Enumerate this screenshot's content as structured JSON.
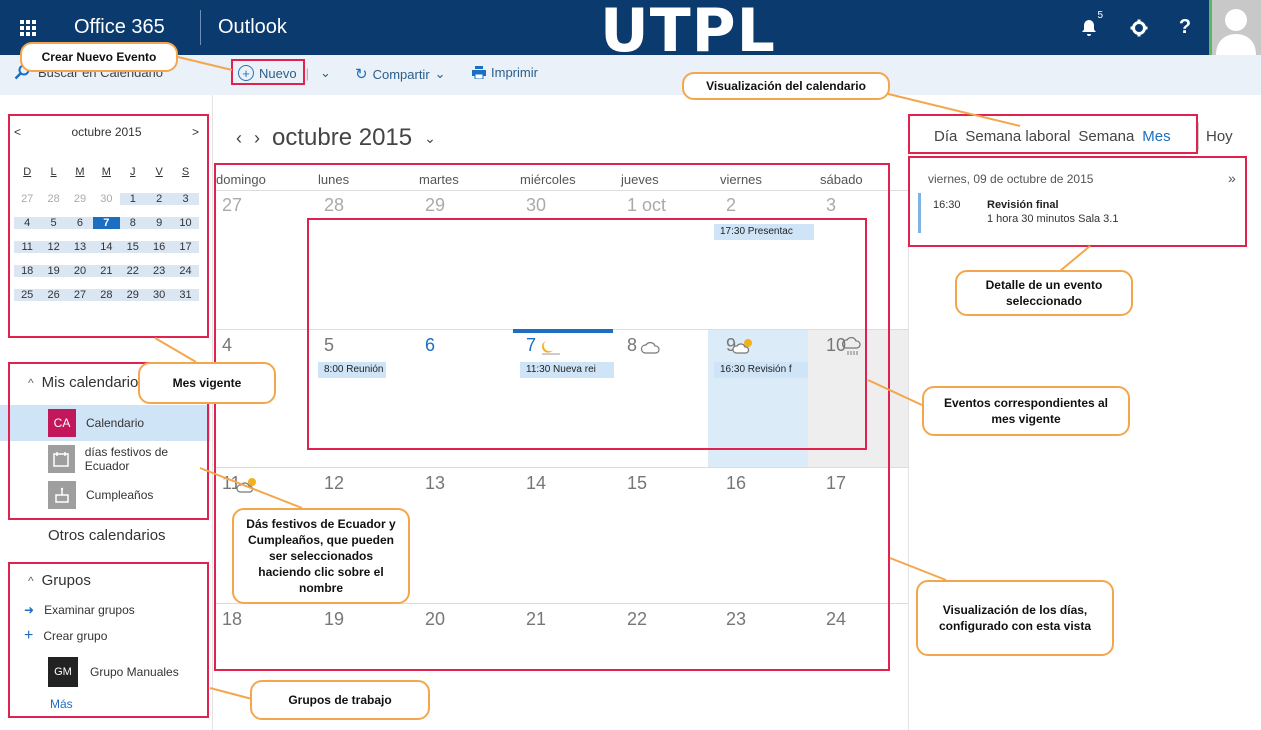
{
  "topbar": {
    "product": "Office 365",
    "app": "Outlook",
    "brand": "UTPL",
    "bell_count": "5",
    "icons": [
      "waffle-icon",
      "bell-icon",
      "gear-icon",
      "help-icon",
      "avatar-icon"
    ],
    "help_label": "?"
  },
  "commands": {
    "search_placeholder": "Buscar en Calendario",
    "new_label": "Nuevo",
    "share_label": "Compartir",
    "print_label": "Imprimir"
  },
  "mini_calendar": {
    "title": "octubre 2015",
    "dow": [
      "D",
      "L",
      "M",
      "M",
      "J",
      "V",
      "S"
    ],
    "weeks": [
      [
        "27",
        "28",
        "29",
        "30",
        "1",
        "2",
        "3"
      ],
      [
        "4",
        "5",
        "6",
        "7",
        "8",
        "9",
        "10"
      ],
      [
        "11",
        "12",
        "13",
        "14",
        "15",
        "16",
        "17"
      ],
      [
        "18",
        "19",
        "20",
        "21",
        "22",
        "23",
        "24"
      ],
      [
        "25",
        "26",
        "27",
        "28",
        "29",
        "30",
        "31"
      ]
    ]
  },
  "my_calendars": {
    "header": "Mis calendarios",
    "items": [
      {
        "badge": "CA",
        "label": "Calendario",
        "color": "#c2185b"
      },
      {
        "badge": "",
        "label": "días festivos de Ecuador",
        "color": "#9e9e9e"
      },
      {
        "badge": "",
        "label": "Cumpleaños",
        "color": "#9e9e9e"
      }
    ],
    "other": "Otros calendarios"
  },
  "groups": {
    "header": "Grupos",
    "browse": "Examinar grupos",
    "create": "Crear grupo",
    "group_badge": "GM",
    "group_name": "Grupo Manuales",
    "more": "Más"
  },
  "main": {
    "month_title": "octubre 2015",
    "columns": [
      "domingo",
      "lunes",
      "martes",
      "miércoles",
      "jueves",
      "viernes",
      "sábado"
    ],
    "weeks": [
      [
        "27",
        "28",
        "29",
        "30",
        "1 oct",
        "2",
        "3"
      ],
      [
        "4",
        "5",
        "6",
        "7",
        "8",
        "9",
        "10"
      ],
      [
        "11",
        "12",
        "13",
        "14",
        "15",
        "16",
        "17"
      ],
      [
        "18",
        "19",
        "20",
        "21",
        "22",
        "23",
        "24"
      ]
    ],
    "events": [
      {
        "label": "17:30 Presentac"
      },
      {
        "label": "8:00 Reunión"
      },
      {
        "label": "11:30 Nueva rei"
      },
      {
        "label": "16:30 Revisión f"
      }
    ]
  },
  "views": {
    "items": [
      "Día",
      "Semana laboral",
      "Semana",
      "Mes"
    ],
    "active": "Mes",
    "today": "Hoy"
  },
  "detail": {
    "date": "viernes, 09 de octubre de 2015",
    "time": "16:30",
    "title": "Revisión final",
    "subtitle": "1 hora 30 minutos  Sala 3.1"
  },
  "callouts": {
    "new_event": "Crear Nuevo Evento",
    "view_mode": "Visualización del calendario",
    "detail": "Detalle de un evento seleccionado",
    "month": "Mes vigente",
    "events": "Eventos correspondientes al mes vigente",
    "holidays": "Dás festivos de Ecuador y Cumpleaños, que pueden ser seleccionados haciendo clic sobre el nombre",
    "days_view": "Visualización de los días, configurado con esta vista",
    "groups": "Grupos de trabajo"
  },
  "colors": {
    "topbar": "#0b3a6f",
    "accent": "#1b6ec2",
    "annotation_box": "#e0234e",
    "callout_border": "#f4a64c"
  }
}
